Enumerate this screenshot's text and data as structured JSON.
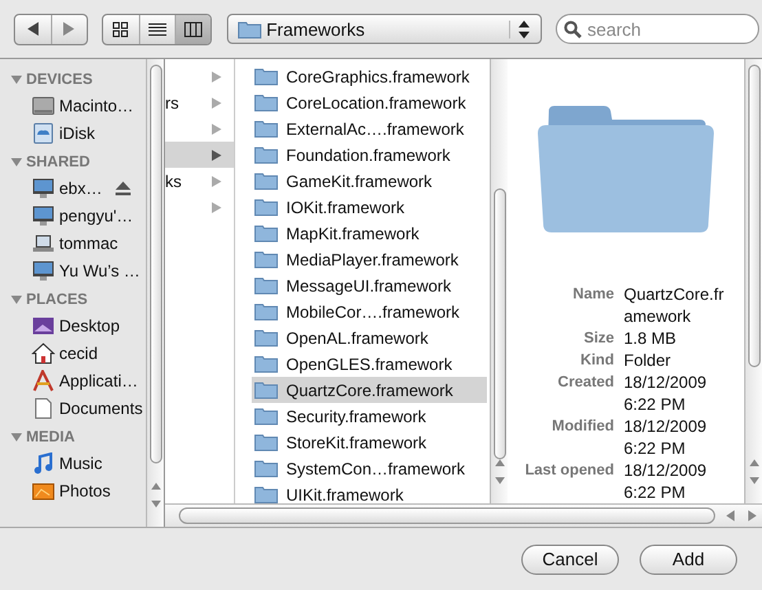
{
  "toolbar": {
    "views": [
      {
        "selected": false
      },
      {
        "selected": false
      },
      {
        "selected": true
      }
    ],
    "path": "Frameworks",
    "search": {
      "placeholder": "search"
    }
  },
  "sidebar": [
    {
      "heading": "DEVICES",
      "expanded": true,
      "items": [
        {
          "label": "Macinto…",
          "eject": false
        },
        {
          "label": "iDisk",
          "eject": false
        }
      ]
    },
    {
      "heading": "SHARED",
      "expanded": true,
      "items": [
        {
          "label": "ebx…",
          "eject": true
        },
        {
          "label": "pengyu'…",
          "eject": false
        },
        {
          "label": "tommac",
          "eject": false
        },
        {
          "label": "Yu Wu’s …",
          "eject": false
        }
      ]
    },
    {
      "heading": "PLACES",
      "expanded": true,
      "items": [
        {
          "label": "Desktop",
          "eject": false
        },
        {
          "label": "cecid",
          "eject": false
        },
        {
          "label": "Applicati…",
          "eject": false
        },
        {
          "label": "Documents",
          "eject": false
        }
      ]
    },
    {
      "heading": "MEDIA",
      "expanded": true,
      "items": [
        {
          "label": "Music",
          "eject": false
        },
        {
          "label": "Photos",
          "eject": false
        }
      ]
    }
  ],
  "column_1": [
    {
      "selected": false
    },
    {
      "text": "rs",
      "selected": false
    },
    {
      "selected": false
    },
    {
      "selected": true
    },
    {
      "text": "ks",
      "selected": false
    },
    {
      "selected": false
    }
  ],
  "column_2": [
    {
      "name": "CoreGraphics.framework",
      "selected": false
    },
    {
      "name": "CoreLocation.framework",
      "selected": false
    },
    {
      "name": "ExternalAc….framework",
      "selected": false
    },
    {
      "name": "Foundation.framework",
      "selected": false
    },
    {
      "name": "GameKit.framework",
      "selected": false
    },
    {
      "name": "IOKit.framework",
      "selected": false
    },
    {
      "name": "MapKit.framework",
      "selected": false
    },
    {
      "name": "MediaPlayer.framework",
      "selected": false
    },
    {
      "name": "MessageUI.framework",
      "selected": false
    },
    {
      "name": "MobileCor….framework",
      "selected": false
    },
    {
      "name": "OpenAL.framework",
      "selected": false
    },
    {
      "name": "OpenGLES.framework",
      "selected": false
    },
    {
      "name": "QuartzCore.framework",
      "selected": true
    },
    {
      "name": "Security.framework",
      "selected": false
    },
    {
      "name": "StoreKit.framework",
      "selected": false
    },
    {
      "name": "SystemCon…framework",
      "selected": false
    },
    {
      "name": "UIKit.framework",
      "selected": false
    }
  ],
  "preview": {
    "info": [
      {
        "label": "Name",
        "value": "QuartzCore.framework"
      },
      {
        "label": "Size",
        "value": "1.8 MB"
      },
      {
        "label": "Kind",
        "value": "Folder"
      },
      {
        "label": "Created",
        "value": "18/12/2009 6:22 PM"
      },
      {
        "label": "Modified",
        "value": "18/12/2009 6:22 PM"
      },
      {
        "label": "Last opened",
        "value": "18/12/2009 6:22 PM"
      }
    ]
  },
  "buttons": [
    {
      "label": "Cancel",
      "default": false
    },
    {
      "label": "Add",
      "default": false
    }
  ]
}
